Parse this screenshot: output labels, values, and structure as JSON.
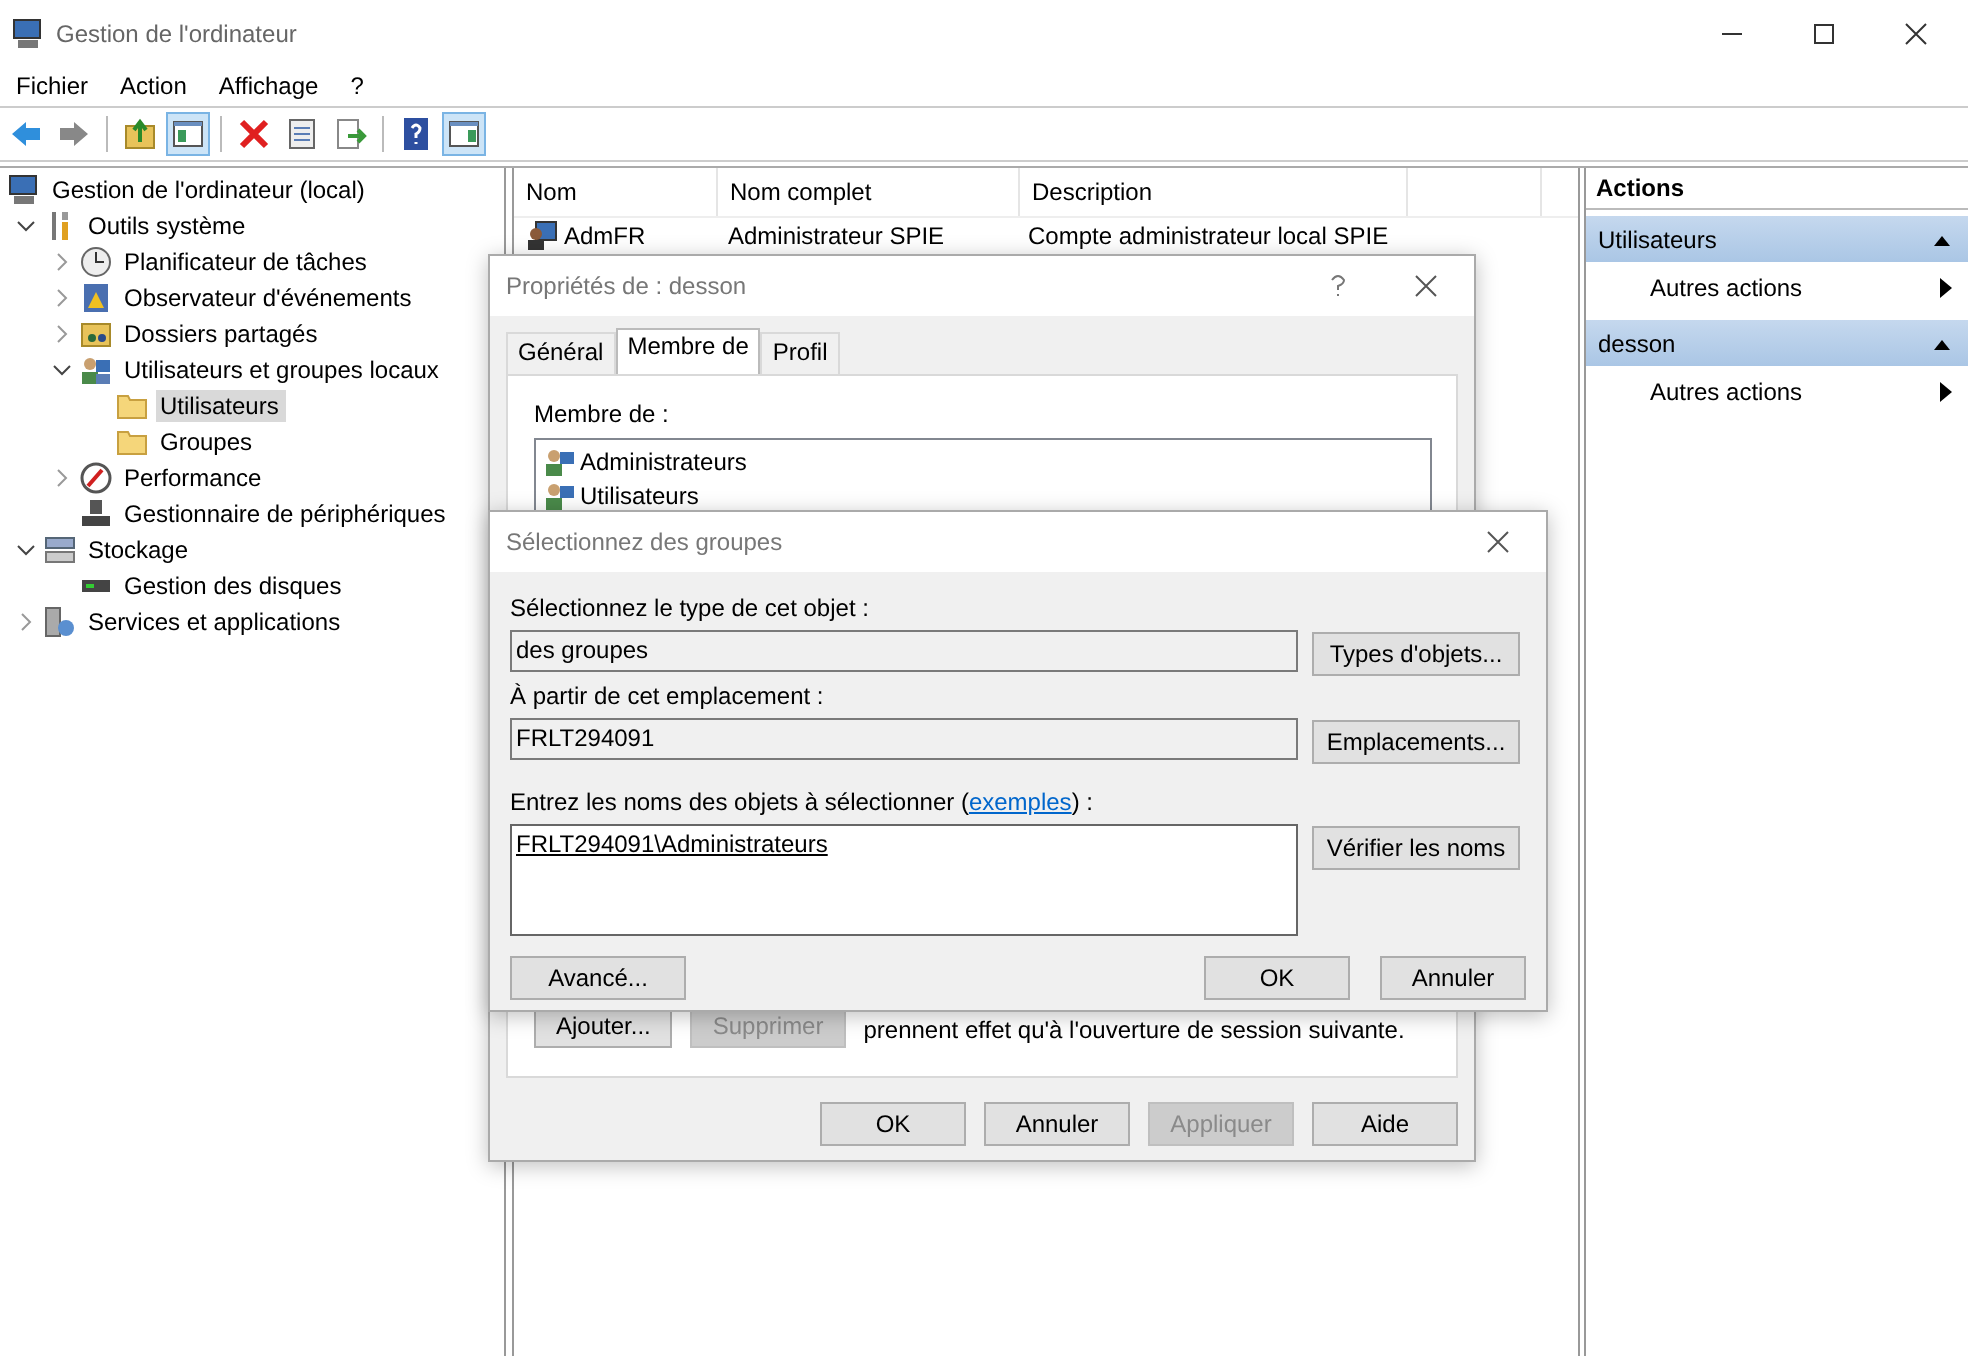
{
  "window": {
    "title": "Gestion de l'ordinateur"
  },
  "menu": [
    "Fichier",
    "Action",
    "Affichage",
    "?"
  ],
  "toolbar": [
    {
      "kind": "back",
      "pressed": false
    },
    {
      "kind": "forward",
      "pressed": false
    },
    {
      "kind": "separator"
    },
    {
      "kind": "up",
      "pressed": false
    },
    {
      "kind": "tree",
      "pressed": true
    },
    {
      "kind": "separator"
    },
    {
      "kind": "delete",
      "pressed": false
    },
    {
      "kind": "properties",
      "pressed": false
    },
    {
      "kind": "export",
      "pressed": false
    },
    {
      "kind": "separator"
    },
    {
      "kind": "help",
      "pressed": false
    },
    {
      "kind": "actions",
      "pressed": true
    }
  ],
  "tree": [
    {
      "label": "Gestion de l'ordinateur (local)",
      "kind": "computer",
      "selected": false,
      "children": [
        {
          "label": "Outils système",
          "kind": "tools",
          "selected": false,
          "expanded": true,
          "children": [
            {
              "label": "Planificateur de tâches",
              "kind": "clock",
              "selected": false,
              "expanded": false
            },
            {
              "label": "Observateur d'événements",
              "kind": "event",
              "selected": false,
              "expanded": false
            },
            {
              "label": "Dossiers partagés",
              "kind": "share",
              "selected": false,
              "expanded": false
            },
            {
              "label": "Utilisateurs et groupes locaux",
              "kind": "users",
              "selected": false,
              "expanded": true,
              "children": [
                {
                  "label": "Utilisateurs",
                  "kind": "folder",
                  "selected": true
                },
                {
                  "label": "Groupes",
                  "kind": "folder",
                  "selected": false
                }
              ]
            },
            {
              "label": "Performance",
              "kind": "perf",
              "selected": false,
              "expanded": false
            },
            {
              "label": "Gestionnaire de périphériques",
              "kind": "device",
              "selected": false
            }
          ]
        },
        {
          "label": "Stockage",
          "kind": "storage",
          "selected": false,
          "expanded": true,
          "children": [
            {
              "label": "Gestion des disques",
              "kind": "disk",
              "selected": false
            }
          ]
        },
        {
          "label": "Services et applications",
          "kind": "services",
          "selected": false,
          "expanded": false
        }
      ]
    }
  ],
  "table": {
    "columns": [
      "Nom",
      "Nom complet",
      "Description"
    ],
    "rows": [
      {
        "name": "AdmFR",
        "full_name": "Administrateur SPIE",
        "description": "Compte administrateur local SPIE"
      }
    ]
  },
  "actions": {
    "title": "Actions",
    "sections": [
      {
        "title": "Utilisateurs",
        "expanded": true,
        "items": [
          "Autres actions"
        ]
      },
      {
        "title": "desson",
        "expanded": true,
        "items": [
          "Autres actions"
        ]
      }
    ]
  },
  "properties_dialog": {
    "title": "Propriétés de : desson",
    "tabs": [
      {
        "label": "Général",
        "selected": false
      },
      {
        "label": "Membre de",
        "selected": true
      },
      {
        "label": "Profil",
        "selected": false
      }
    ],
    "member_label": "Membre de :",
    "members": [
      "Administrateurs",
      "Utilisateurs"
    ],
    "list_buttons": [
      {
        "label": "Ajouter...",
        "disabled": false
      },
      {
        "label": "Supprimer",
        "disabled": true
      }
    ],
    "note": "prennent effet qu'à l'ouverture de session suivante.",
    "buttons": [
      {
        "label": "OK",
        "disabled": false
      },
      {
        "label": "Annuler",
        "disabled": false
      },
      {
        "label": "Appliquer",
        "disabled": true
      },
      {
        "label": "Aide",
        "disabled": false
      }
    ]
  },
  "select_dialog": {
    "title": "Sélectionnez des groupes",
    "type_label": "Sélectionnez le type de cet objet :",
    "type_value": "des groupes",
    "type_button": "Types d'objets...",
    "location_label": "À partir de cet emplacement :",
    "location_value": "FRLT294091",
    "location_button": "Emplacements...",
    "names_label_before": "Entrez les noms des objets à sélectionner (",
    "names_link": "exemples",
    "names_label_after": ") :",
    "names_value": "FRLT294091\\Administrateurs",
    "check_button": "Vérifier les noms",
    "advanced_button": "Avancé...",
    "buttons": [
      "OK",
      "Annuler"
    ]
  }
}
